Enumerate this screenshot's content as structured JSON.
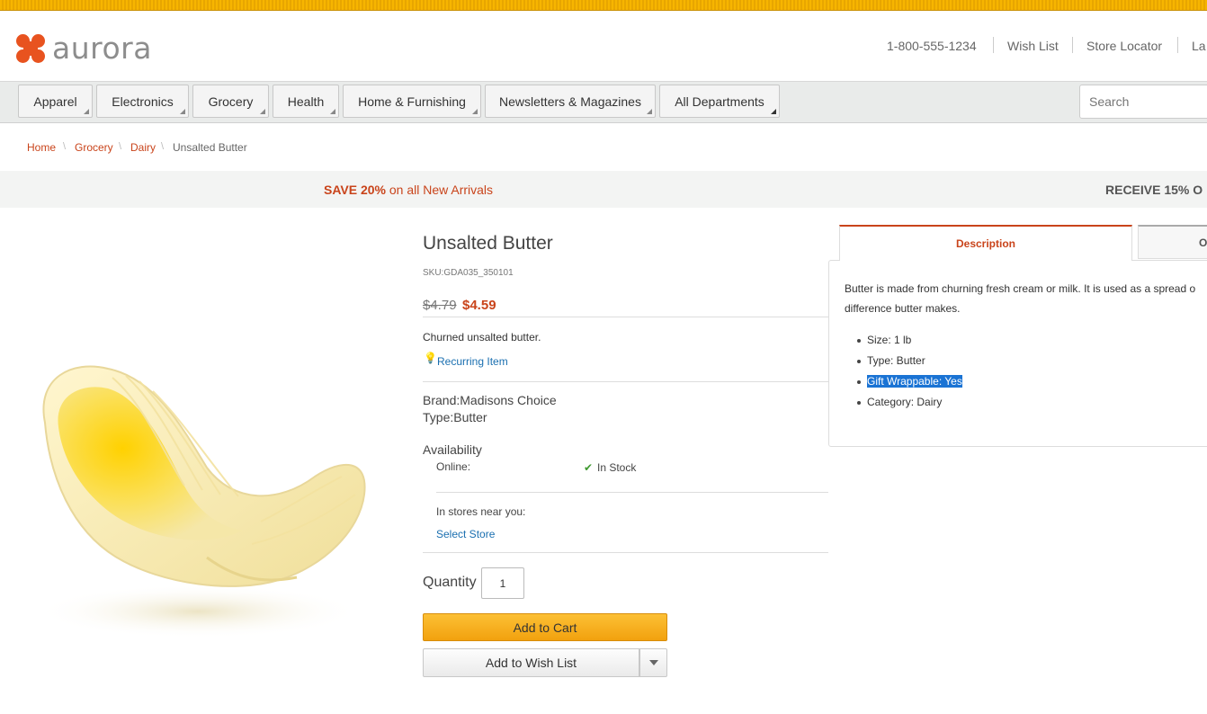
{
  "header": {
    "brand": "aurora",
    "phone": "1-800-555-1234",
    "wish_list": "Wish List",
    "store_locator": "Store Locator",
    "language_partial": "La"
  },
  "nav": {
    "departments": [
      "Apparel",
      "Electronics",
      "Grocery",
      "Health",
      "Home & Furnishing",
      "Newsletters & Magazines",
      "All Departments"
    ],
    "search_placeholder": "Search"
  },
  "breadcrumb": [
    "Home",
    "Grocery",
    "Dairy",
    "Unsalted Butter"
  ],
  "promo": {
    "left_bold": "SAVE 20%",
    "left_rest": " on all New Arrivals",
    "right_partial": "RECEIVE 15% O"
  },
  "product": {
    "title": "Unsalted Butter",
    "sku": "SKU:GDA035_350101",
    "old_price": "$4.79",
    "new_price": "$4.59",
    "short_description": "Churned unsalted butter.",
    "recurring": "Recurring Item",
    "brand": "Brand:Madisons Choice",
    "type": "Type:Butter",
    "availability_label": "Availability",
    "online_label": "Online:",
    "stock_status": "In Stock",
    "stores_label": "In stores near you:",
    "select_store": "Select Store",
    "quantity_label": "Quantity",
    "quantity_value": "1",
    "add_to_cart": "Add to Cart",
    "add_to_wish_list": "Add to Wish List"
  },
  "tabs": {
    "active": "Description",
    "other_partial": "O",
    "description_line1": "Butter is made from churning fresh cream or milk. It is used as a spread o",
    "description_line2": "difference butter makes.",
    "specs": [
      "Size: 1 lb",
      "Type: Butter",
      "Gift Wrappable: Yes",
      "Category: Dairy"
    ]
  },
  "colors": {
    "accent": "#c9441b",
    "link": "#1a6fb0",
    "cart_button": "#f7b21d",
    "selection": "#1a73d4"
  }
}
